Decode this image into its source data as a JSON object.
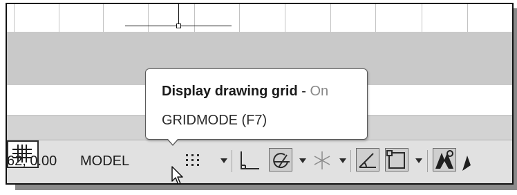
{
  "tooltip": {
    "title": "Display drawing grid",
    "separator": " - ",
    "state": "On",
    "command": "GRIDMODE (F7)"
  },
  "statusbar": {
    "coordinates": "62, 0.00",
    "model_label": "MODEL",
    "tools": [
      {
        "name": "grid",
        "icon": "grid-icon",
        "active": true
      },
      {
        "name": "snap",
        "icon": "snap-dots-icon"
      },
      {
        "name": "ortho",
        "icon": "ortho-icon"
      },
      {
        "name": "polar",
        "icon": "polar-tracking-icon",
        "active": true
      },
      {
        "name": "isodraft",
        "icon": "isometric-icon"
      },
      {
        "name": "object-snap-tracking",
        "icon": "object-snap-tracking-icon",
        "active": true
      },
      {
        "name": "object-snap",
        "icon": "object-snap-icon",
        "active": true
      },
      {
        "name": "annotation-visibility",
        "icon": "annotation-icon",
        "active": true
      }
    ]
  },
  "colors": {
    "statusbar_bg": "#e1e1e1",
    "band_gray": "#c9c9c9",
    "tooltip_state": "#888888"
  }
}
